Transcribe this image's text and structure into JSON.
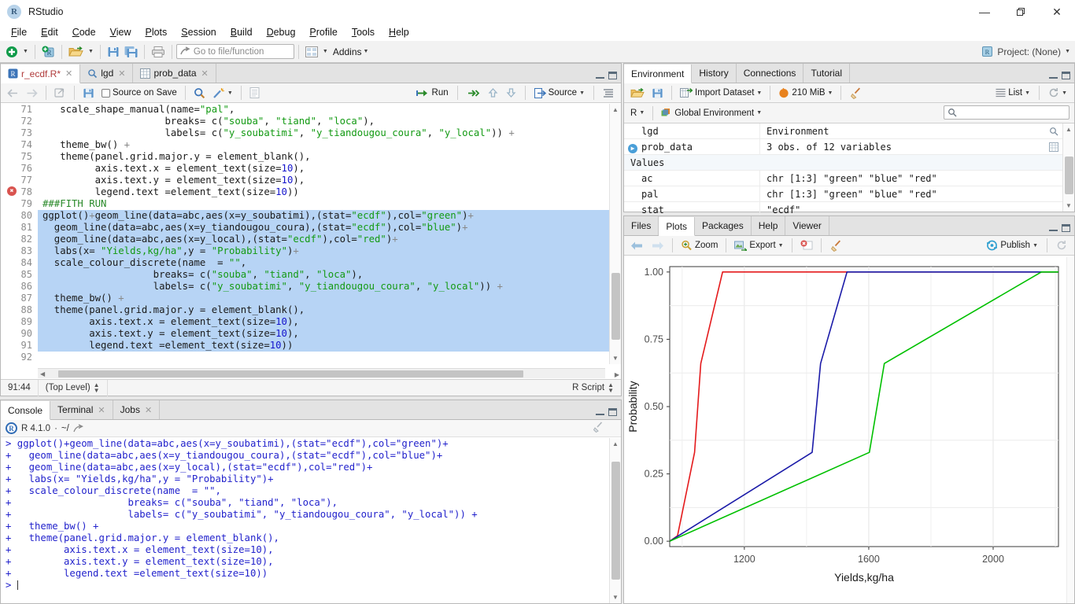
{
  "window": {
    "app_name": "RStudio",
    "app_icon": "R",
    "minimize": "—",
    "maximize": "❐",
    "close": "✕"
  },
  "menubar": [
    {
      "label": "File"
    },
    {
      "label": "Edit"
    },
    {
      "label": "Code"
    },
    {
      "label": "View"
    },
    {
      "label": "Plots"
    },
    {
      "label": "Session"
    },
    {
      "label": "Build"
    },
    {
      "label": "Debug"
    },
    {
      "label": "Profile"
    },
    {
      "label": "Tools"
    },
    {
      "label": "Help"
    }
  ],
  "toolbar": {
    "new_file": "new-file-icon",
    "new_project": "new-project-icon",
    "open_file": "open-folder-icon",
    "save": "save-icon",
    "save_all": "save-all-icon",
    "print": "print-icon",
    "goto_placeholder": "Go to file/function",
    "panes_icon": "panes-layout-icon",
    "addins_label": "Addins",
    "project_label": "Project: (None)"
  },
  "source": {
    "tabs": [
      {
        "label": "r_ecdf.R*",
        "icon": "r-script-icon",
        "active": true,
        "closable": true
      },
      {
        "label": "lgd",
        "icon": "magnifier-icon",
        "active": false,
        "closable": true
      },
      {
        "label": "prob_data",
        "icon": "data-grid-icon",
        "active": false,
        "closable": true
      }
    ],
    "toolbar": {
      "back": "back-arrow-icon",
      "forward": "forward-arrow-icon",
      "popout": "show-in-new-window-icon",
      "save": "save-icon",
      "source_on_save_label": "Source on Save",
      "find": "magnifier-icon",
      "code_tools": "magic-wand-icon",
      "compile_report": "compile-report-icon",
      "run_label": "Run",
      "rerun": "rerun-icon",
      "up": "up-arrow-icon",
      "down": "down-arrow-icon",
      "source_label": "Source",
      "outline": "document-outline-icon"
    },
    "lines": [
      {
        "n": 71,
        "text": "   scale_shape_manual(name=\"pal\",",
        "sel": false,
        "err": false
      },
      {
        "n": 72,
        "text": "                     breaks= c(\"souba\", \"tiand\", \"loca\"),",
        "sel": false,
        "err": false
      },
      {
        "n": 73,
        "text": "                     labels= c(\"y_soubatimi\", \"y_tiandougou_coura\", \"y_local\")) +",
        "sel": false,
        "err": false
      },
      {
        "n": 74,
        "text": "   theme_bw() +",
        "sel": false,
        "err": false
      },
      {
        "n": 75,
        "text": "   theme(panel.grid.major.y = element_blank(),",
        "sel": false,
        "err": false
      },
      {
        "n": 76,
        "text": "         axis.text.x = element_text(size=10),",
        "sel": false,
        "err": false
      },
      {
        "n": 77,
        "text": "         axis.text.y = element_text(size=10),",
        "sel": false,
        "err": false
      },
      {
        "n": 78,
        "text": "         legend.text =element_text(size=10))",
        "sel": false,
        "err": true
      },
      {
        "n": 79,
        "text": "###FITH RUN",
        "sel": false,
        "err": false,
        "comment": true
      },
      {
        "n": 80,
        "text": "ggplot()+geom_line(data=abc,aes(x=y_soubatimi),(stat=\"ecdf\"),col=\"green\")+",
        "sel": true,
        "err": false
      },
      {
        "n": 81,
        "text": "  geom_line(data=abc,aes(x=y_tiandougou_coura),(stat=\"ecdf\"),col=\"blue\")+",
        "sel": true,
        "err": false
      },
      {
        "n": 82,
        "text": "  geom_line(data=abc,aes(x=y_local),(stat=\"ecdf\"),col=\"red\")+",
        "sel": true,
        "err": false
      },
      {
        "n": 83,
        "text": "  labs(x= \"Yields,kg/ha\",y = \"Probability\")+",
        "sel": true,
        "err": false
      },
      {
        "n": 84,
        "text": "  scale_colour_discrete(name  = \"\",",
        "sel": true,
        "err": false
      },
      {
        "n": 85,
        "text": "                   breaks= c(\"souba\", \"tiand\", \"loca\"),",
        "sel": true,
        "err": false
      },
      {
        "n": 86,
        "text": "                   labels= c(\"y_soubatimi\", \"y_tiandougou_coura\", \"y_local\")) +",
        "sel": true,
        "err": false
      },
      {
        "n": 87,
        "text": "  theme_bw() +",
        "sel": true,
        "err": false
      },
      {
        "n": 88,
        "text": "  theme(panel.grid.major.y = element_blank(),",
        "sel": true,
        "err": false
      },
      {
        "n": 89,
        "text": "        axis.text.x = element_text(size=10),",
        "sel": true,
        "err": false
      },
      {
        "n": 90,
        "text": "        axis.text.y = element_text(size=10),",
        "sel": true,
        "err": false
      },
      {
        "n": 91,
        "text": "        legend.text =element_text(size=10))",
        "sel": true,
        "err": false
      },
      {
        "n": 92,
        "text": "",
        "sel": false,
        "err": false
      },
      {
        "n": 93,
        "text": "",
        "sel": false,
        "err": false
      }
    ],
    "status": {
      "cursor_position": "91:44",
      "scope": "(Top Level)",
      "file_type": "R Script"
    }
  },
  "console": {
    "tabs": [
      {
        "label": "Console",
        "active": true,
        "closable": false
      },
      {
        "label": "Terminal",
        "active": false,
        "closable": true
      },
      {
        "label": "Jobs",
        "active": false,
        "closable": true
      }
    ],
    "r_badge": "R",
    "r_version": "R 4.1.0",
    "working_dir": "~/",
    "popout_icon": "popout-icon",
    "clear_icon": "broom-icon",
    "output_lines": [
      "> ggplot()+geom_line(data=abc,aes(x=y_soubatimi),(stat=\"ecdf\"),col=\"green\")+",
      "+   geom_line(data=abc,aes(x=y_tiandougou_coura),(stat=\"ecdf\"),col=\"blue\")+",
      "+   geom_line(data=abc,aes(x=y_local),(stat=\"ecdf\"),col=\"red\")+",
      "+   labs(x= \"Yields,kg/ha\",y = \"Probability\")+",
      "+   scale_colour_discrete(name  = \"\",",
      "+                    breaks= c(\"souba\", \"tiand\", \"loca\"),",
      "+                    labels= c(\"y_soubatimi\", \"y_tiandougou_coura\", \"y_local\")) +",
      "+   theme_bw() +",
      "+   theme(panel.grid.major.y = element_blank(),",
      "+         axis.text.x = element_text(size=10),",
      "+         axis.text.y = element_text(size=10),",
      "+         legend.text =element_text(size=10))",
      ">"
    ]
  },
  "environment": {
    "tabs": [
      {
        "label": "Environment",
        "active": true
      },
      {
        "label": "History",
        "active": false
      },
      {
        "label": "Connections",
        "active": false
      },
      {
        "label": "Tutorial",
        "active": false
      }
    ],
    "toolbar": {
      "load": "open-folder-icon",
      "save": "save-icon",
      "import_label": "Import Dataset",
      "memory_label": "210 MiB",
      "clear": "broom-icon",
      "view_label": "List",
      "refresh": "refresh-icon"
    },
    "scope": {
      "language": "R",
      "environment_label": "Global Environment",
      "search_placeholder": ""
    },
    "rows": [
      {
        "name": "lgd",
        "value": "Environment",
        "kind": "object",
        "action": "magnifier-icon",
        "expandable": false
      },
      {
        "name": "prob_data",
        "value": "3 obs. of 12 variables",
        "kind": "object",
        "action": "data-grid-icon",
        "expandable": true
      },
      {
        "name": "Values",
        "value": "",
        "kind": "group",
        "action": "",
        "expandable": false
      },
      {
        "name": "ac",
        "value": "chr [1:3] \"green\" \"blue\" \"red\"",
        "kind": "value",
        "action": "",
        "expandable": false
      },
      {
        "name": "pal",
        "value": "chr [1:3] \"green\" \"blue\" \"red\"",
        "kind": "value",
        "action": "",
        "expandable": false
      },
      {
        "name": "stat",
        "value": "\"ecdf\"",
        "kind": "value",
        "action": "",
        "expandable": false
      }
    ]
  },
  "plots": {
    "tabs": [
      {
        "label": "Files",
        "active": false
      },
      {
        "label": "Plots",
        "active": true
      },
      {
        "label": "Packages",
        "active": false
      },
      {
        "label": "Help",
        "active": false
      },
      {
        "label": "Viewer",
        "active": false
      }
    ],
    "toolbar": {
      "prev": "left-arrow-icon",
      "next": "right-arrow-icon",
      "zoom_label": "Zoom",
      "export_label": "Export",
      "remove": "remove-plot-icon",
      "clear_all": "broom-icon",
      "publish_label": "Publish",
      "refresh": "refresh-icon"
    }
  },
  "chart_data": {
    "type": "line",
    "title": "",
    "xlabel": "Yields,kg/ha",
    "ylabel": "Probability",
    "xlim": [
      960,
      2210
    ],
    "ylim": [
      -0.02,
      1.02
    ],
    "xticks": [
      1200,
      1600,
      2000
    ],
    "xtick_labels": [
      "1200",
      "1600",
      "2000"
    ],
    "yticks": [
      0.0,
      0.25,
      0.5,
      0.75,
      1.0
    ],
    "ytick_labels": [
      "0.00",
      "0.25",
      "0.50",
      "0.75",
      "1.00"
    ],
    "grid": "major-x-and-minor-y",
    "legend": "none",
    "theme": "theme_bw",
    "series": [
      {
        "name": "y_local",
        "color": "#e41a1c",
        "label": "loca",
        "points": [
          [
            960,
            0.0
          ],
          [
            985,
            0.02
          ],
          [
            1040,
            0.33
          ],
          [
            1060,
            0.66
          ],
          [
            1130,
            1.0
          ],
          [
            2210,
            1.0
          ]
        ]
      },
      {
        "name": "y_tiandougou_coura",
        "color": "#1a1aa8",
        "label": "tiand",
        "points": [
          [
            960,
            0.0
          ],
          [
            1418,
            0.33
          ],
          [
            1445,
            0.66
          ],
          [
            1530,
            1.0
          ],
          [
            2210,
            1.0
          ]
        ]
      },
      {
        "name": "y_soubatimi",
        "color": "#00c000",
        "label": "souba",
        "points": [
          [
            960,
            0.0
          ],
          [
            1602,
            0.33
          ],
          [
            1650,
            0.66
          ],
          [
            2155,
            1.0
          ],
          [
            2210,
            1.0
          ]
        ]
      }
    ]
  }
}
